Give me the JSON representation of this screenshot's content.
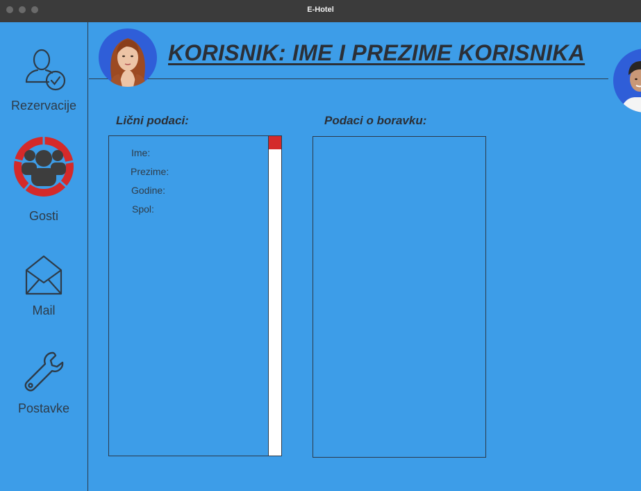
{
  "window": {
    "title": "E-Hotel"
  },
  "sidebar": {
    "items": [
      {
        "label": "Rezervacije",
        "icon": "user-check-icon",
        "active": false
      },
      {
        "label": "Gosti",
        "icon": "group-icon",
        "active": true
      },
      {
        "label": "Mail",
        "icon": "envelope-icon",
        "active": false
      },
      {
        "label": "Postavke",
        "icon": "wrench-icon",
        "active": false
      }
    ]
  },
  "header": {
    "title": "KORISNIK:  IME I PREZIME KORISNIKA"
  },
  "sections": {
    "personal": {
      "title": "Lični podaci:",
      "fields": [
        "Ime:",
        "Prezime:",
        "Godine:",
        "Spol:"
      ]
    },
    "stay": {
      "title": "Podaci o boravku:"
    }
  },
  "colors": {
    "background": "#3d9de8",
    "accent": "#d42a2a",
    "text": "#2e3b48",
    "avatar_bg": "#2f5ed8"
  }
}
